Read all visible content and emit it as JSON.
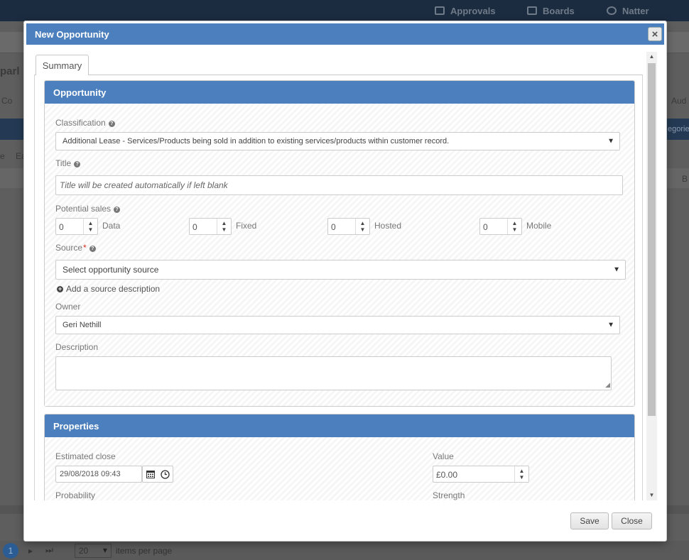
{
  "background": {
    "nav": {
      "approvals": "Approvals",
      "boards": "Boards",
      "natter": "Natter"
    },
    "fragments": {
      "left1": "parl",
      "left2": "Co",
      "right1": "Aud",
      "right2": "egories",
      "right3": "B",
      "left3": "e",
      "left4": "Ea"
    },
    "footer": {
      "page": "1",
      "per_page_value": "20",
      "per_page_label": "items per page"
    }
  },
  "modal": {
    "title": "New Opportunity",
    "close_symbol": "×",
    "tab_summary": "Summary",
    "opportunity": {
      "heading": "Opportunity",
      "classification_label": "Classification",
      "classification_value": "Additional Lease - Services/Products being sold in addition to existing services/products within customer record.",
      "title_label": "Title",
      "title_placeholder": "Title will be created automatically if left blank",
      "potential_sales_label": "Potential sales",
      "sales": [
        {
          "value": "0",
          "label": "Data"
        },
        {
          "value": "0",
          "label": "Fixed"
        },
        {
          "value": "0",
          "label": "Hosted"
        },
        {
          "value": "0",
          "label": "Mobile"
        }
      ],
      "source_label": "Source",
      "source_required": "*",
      "source_value": "Select opportunity source",
      "add_source_description": "Add a source description",
      "owner_label": "Owner",
      "owner_value": "Geri Nethill",
      "description_label": "Description",
      "description_value": ""
    },
    "properties": {
      "heading": "Properties",
      "estimated_close_label": "Estimated close",
      "estimated_close_value": "29/08/2018 09:43",
      "value_label": "Value",
      "value_value": "£0.00",
      "probability_label": "Probability",
      "strength_label": "Strength"
    },
    "buttons": {
      "save": "Save",
      "close": "Close"
    }
  },
  "icons": {
    "help": "question-circle-icon",
    "calendar": "calendar-icon",
    "clock": "clock-icon",
    "plus": "plus-circle-icon"
  }
}
